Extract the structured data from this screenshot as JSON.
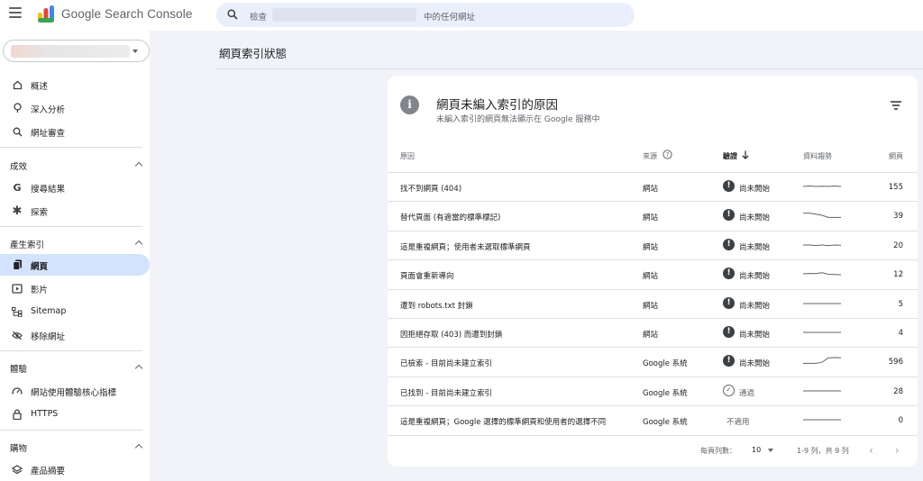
{
  "app": {
    "title": "Google Search Console",
    "search_prefix": "檢查",
    "search_suffix": "中的任何網址"
  },
  "sidebar": {
    "items_top": [
      {
        "label": "概述",
        "icon": "home-icon"
      },
      {
        "label": "深入分析",
        "icon": "lightbulb-icon"
      },
      {
        "label": "網址審查",
        "icon": "search-icon"
      }
    ],
    "sections": [
      {
        "title": "成效",
        "items": [
          {
            "label": "搜尋結果",
            "icon": "google-g-icon"
          },
          {
            "label": "探索",
            "icon": "asterisk-icon"
          }
        ]
      },
      {
        "title": "產生索引",
        "items": [
          {
            "label": "網頁",
            "icon": "pages-icon"
          },
          {
            "label": "影片",
            "icon": "video-icon"
          },
          {
            "label": "Sitemap",
            "icon": "sitemap-icon"
          },
          {
            "label": "移除網址",
            "icon": "remove-eye-icon"
          }
        ]
      },
      {
        "title": "體驗",
        "items": [
          {
            "label": "網站使用體驗核心指標",
            "icon": "speed-icon"
          },
          {
            "label": "HTTPS",
            "icon": "lock-icon"
          }
        ]
      },
      {
        "title": "購物",
        "items": [
          {
            "label": "產品摘要",
            "icon": "layers-icon"
          }
        ]
      }
    ]
  },
  "main": {
    "page_title": "網頁索引狀態",
    "card": {
      "title": "網頁未編入索引的原因",
      "subtitle": "未編入索引的網頁無法顯示在 Google 服務中",
      "columns": {
        "reason": "原因",
        "source": "來源",
        "validation": "驗證",
        "trend": "資料趨勢",
        "pages": "網頁"
      },
      "rows": [
        {
          "reason": "找不到網頁 (404)",
          "source": "網站",
          "status": "尚未開始",
          "status_type": "pending",
          "count": "155",
          "trend": [
            5,
            5.5,
            5,
            5.2,
            5,
            5.4,
            5
          ]
        },
        {
          "reason": "替代頁面 (有適當的標準標記)",
          "source": "網站",
          "status": "尚未開始",
          "status_type": "pending",
          "count": "39",
          "trend": [
            7,
            7,
            6,
            5,
            3,
            3,
            3
          ]
        },
        {
          "reason": "這是重複網頁；使用者未選取標準網頁",
          "source": "網站",
          "status": "尚未開始",
          "status_type": "pending",
          "count": "20",
          "trend": [
            5,
            5,
            4.6,
            5,
            4.4,
            5,
            4.8
          ]
        },
        {
          "reason": "頁面會重新導向",
          "source": "網站",
          "status": "尚未開始",
          "status_type": "pending",
          "count": "12",
          "trend": [
            5,
            5.3,
            5.2,
            6,
            4.6,
            4.3,
            4.2
          ]
        },
        {
          "reason": "遭到 robots.txt 封鎖",
          "source": "網站",
          "status": "尚未開始",
          "status_type": "pending",
          "count": "5",
          "trend": [
            5,
            5,
            5,
            5,
            5,
            5,
            5
          ]
        },
        {
          "reason": "因拒絕存取 (403) 而遭到封鎖",
          "source": "網站",
          "status": "尚未開始",
          "status_type": "pending",
          "count": "4",
          "trend": [
            5,
            5,
            5,
            5,
            5,
            5,
            5
          ]
        },
        {
          "reason": "已檢索 - 目前尚未建立索引",
          "source": "Google 系統",
          "status": "尚未開始",
          "status_type": "pending",
          "count": "596",
          "trend": [
            3,
            3,
            3,
            4,
            8,
            8.4,
            8.2
          ]
        },
        {
          "reason": "已找到 - 目前尚未建立索引",
          "source": "Google 系統",
          "status": "通過",
          "status_type": "passed",
          "count": "28",
          "trend": [
            5,
            5,
            5,
            5,
            5,
            5,
            5
          ]
        },
        {
          "reason": "這是重複網頁；Google 選擇的標準網頁和使用者的選擇不同",
          "source": "Google 系統",
          "status": "不適用",
          "status_type": "na",
          "count": "0",
          "trend": [
            5,
            5,
            5,
            5,
            5,
            5,
            5
          ]
        }
      ],
      "pagination": {
        "rows_per_page_label": "每頁列數：",
        "rows_per_page": "10",
        "range": "1-9 列，共 9 列"
      }
    }
  },
  "colors": {
    "active_nav": "#d3e3fd",
    "search_bg": "#eaf0fb",
    "page_bg": "#f1f3f9"
  }
}
